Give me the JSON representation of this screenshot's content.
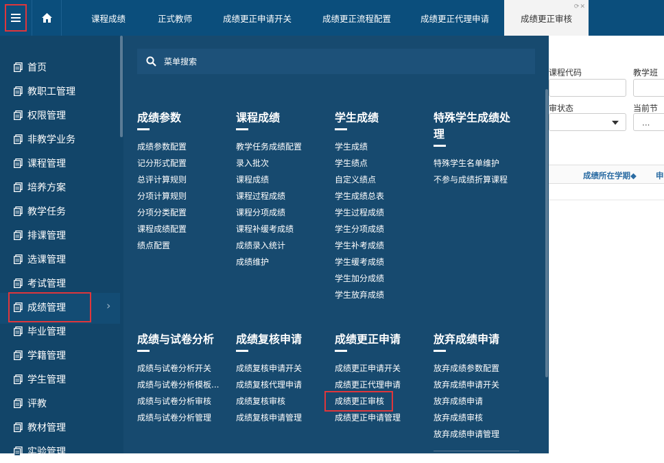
{
  "topbar": {
    "tabs": [
      {
        "label": "课程成绩"
      },
      {
        "label": "正式教师"
      },
      {
        "label": "成绩更正申请开关"
      },
      {
        "label": "成绩更正流程配置"
      },
      {
        "label": "成绩更正代理申请"
      },
      {
        "label": "成绩更正审核",
        "active": true
      }
    ]
  },
  "sidebar": {
    "items": [
      {
        "label": "首页"
      },
      {
        "label": "教职工管理"
      },
      {
        "label": "权限管理"
      },
      {
        "label": "非教学业务"
      },
      {
        "label": "课程管理"
      },
      {
        "label": "培养方案"
      },
      {
        "label": "教学任务"
      },
      {
        "label": "排课管理"
      },
      {
        "label": "选课管理"
      },
      {
        "label": "考试管理"
      },
      {
        "label": "成绩管理",
        "active": true
      },
      {
        "label": "毕业管理"
      },
      {
        "label": "学籍管理"
      },
      {
        "label": "学生管理"
      },
      {
        "label": "评教"
      },
      {
        "label": "教材管理"
      },
      {
        "label": "实验管理"
      }
    ]
  },
  "mega": {
    "search_placeholder": "菜单搜索",
    "groups": [
      {
        "title": "成绩参数",
        "items": [
          "成绩参数配置",
          "记分形式配置",
          "总评计算规则",
          "分项计算规则",
          "分项分类配置",
          "课程成绩配置",
          "绩点配置"
        ]
      },
      {
        "title": "课程成绩",
        "items": [
          "教学任务成绩配置",
          "录入批次",
          "课程成绩",
          "课程过程成绩",
          "课程分项成绩",
          "课程补缓考成绩",
          "成绩录入统计",
          "成绩维护"
        ]
      },
      {
        "title": "学生成绩",
        "items": [
          "学生成绩",
          "学生绩点",
          "自定义绩点",
          "学生成绩总表",
          "学生过程成绩",
          "学生分项成绩",
          "学生补考成绩",
          "学生缓考成绩",
          "学生加分成绩",
          "学生放弃成绩"
        ]
      },
      {
        "title": "特殊学生成绩处理",
        "items": [
          "特殊学生名单维护",
          "不参与成绩折算课程"
        ]
      },
      {
        "title": "成绩与试卷分析",
        "items": [
          "成绩与试卷分析开关",
          "成绩与试卷分析模板...",
          "成绩与试卷分析审核",
          "成绩与试卷分析管理"
        ]
      },
      {
        "title": "成绩复核申请",
        "items": [
          "成绩复核申请开关",
          "成绩复核代理申请",
          "成绩复核审核",
          "成绩复核申请管理"
        ]
      },
      {
        "title": "成绩更正申请",
        "items": [
          "成绩更正申请开关",
          "成绩更正代理申请",
          "成绩更正审核",
          "成绩更正申请管理"
        ]
      },
      {
        "title": "放弃成绩申请",
        "items": [
          "放弃成绩参数配置",
          "放弃成绩申请开关",
          "放弃成绩申请",
          "放弃成绩审核",
          "放弃成绩申请管理"
        ]
      }
    ]
  },
  "background": {
    "labels": {
      "course_code": "课程代码",
      "class_code": "教学班代",
      "status": "审状态",
      "current_node": "当前节点"
    },
    "current_node_value": "...",
    "table_headers": [
      "成绩所在学期◆",
      "申"
    ]
  },
  "colors": {
    "topbar": "#0b4e7c",
    "sidebar": "#124569",
    "mega": "#174a6f",
    "highlight": "#e0363b"
  }
}
